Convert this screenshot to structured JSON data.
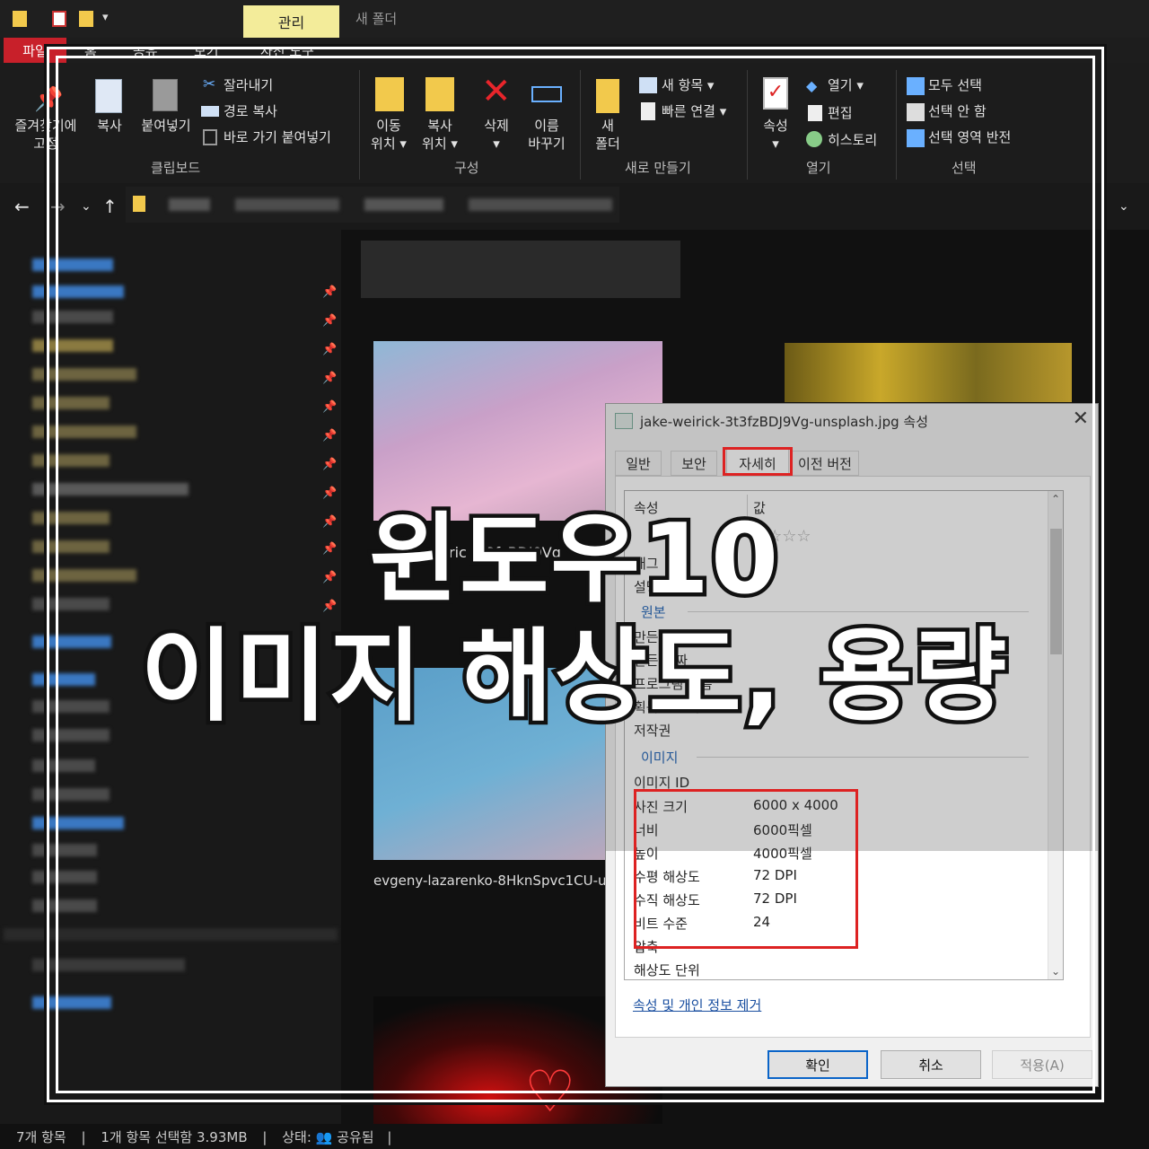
{
  "titlebar": {
    "manage_tab": "관리",
    "folder_title": "새 폴더"
  },
  "menu": {
    "file": "파일",
    "home": "홈",
    "share": "공유",
    "view": "보기",
    "picture_tools": "사진 도구"
  },
  "ribbon": {
    "clipboard": {
      "pin": "즐겨찾기에\n고정",
      "copy": "복사",
      "paste": "붙여넣기",
      "cut": "잘라내기",
      "copy_path": "경로 복사",
      "paste_shortcut": "바로 가기 붙여넣기",
      "group": "클립보드"
    },
    "organize": {
      "move_to": "이동\n위치 ▾",
      "copy_to": "복사\n위치 ▾",
      "delete": "삭제\n▾",
      "rename": "이름\n바꾸기",
      "group": "구성"
    },
    "new": {
      "new_folder": "새\n폴더",
      "new_item": "새 항목 ▾",
      "easy_access": "빠른 연결 ▾",
      "group": "새로 만들기"
    },
    "open": {
      "properties": "속성\n▾",
      "open": "열기 ▾",
      "edit": "편집",
      "history": "히스토리",
      "group": "열기"
    },
    "select": {
      "select_all": "모두 선택",
      "select_none": "선택 안 함",
      "invert": "선택 영역 반전",
      "group": "선택"
    }
  },
  "files": {
    "visible_name_1": "evgeny-lazarenko-8HknSpvc1CU-un",
    "visible_name_2": "ric 3t3fzBDJ9Vg"
  },
  "status": {
    "count": "7개 항목",
    "selected": "1개 항목 선택함 3.93MB",
    "state_label": "상태:",
    "state": "공유됨"
  },
  "dialog": {
    "title": "jake-weirick-3t3fzBDJ9Vg-unsplash.jpg 속성",
    "tabs": [
      "일반",
      "보안",
      "자세히",
      "이전 버전"
    ],
    "active_tab": "자세히",
    "col_property": "속성",
    "col_value": "값",
    "rating_stars": "☆☆☆☆",
    "rows_top": [
      "태그",
      "설명"
    ],
    "section_origin": "원본",
    "rows_origin": [
      "만든 이",
      "만든 날짜",
      "프로그램 이름",
      "획득한 날짜",
      "저작권"
    ],
    "section_image": "이미지",
    "row_image_id": "이미지 ID",
    "image_props": [
      {
        "name": "사진 크기",
        "value": "6000 x 4000"
      },
      {
        "name": "너비",
        "value": "6000픽셀"
      },
      {
        "name": "높이",
        "value": "4000픽셀"
      },
      {
        "name": "수평 해상도",
        "value": "72 DPI"
      },
      {
        "name": "수직 해상도",
        "value": "72 DPI"
      },
      {
        "name": "비트 수준",
        "value": "24"
      }
    ],
    "row_compression": "압축",
    "row_resolution_unit": "해상도 단위",
    "remove_link": "속성 및 개인 정보 제거",
    "ok": "확인",
    "cancel": "취소",
    "apply": "적용(A)"
  },
  "overlay": {
    "line1": "윈도우10",
    "line2": "이미지 해상도, 용량"
  },
  "colors": {
    "accent_red": "#d22222",
    "manage_tab": "#f3ec9a",
    "file_tab": "#c8202a"
  }
}
